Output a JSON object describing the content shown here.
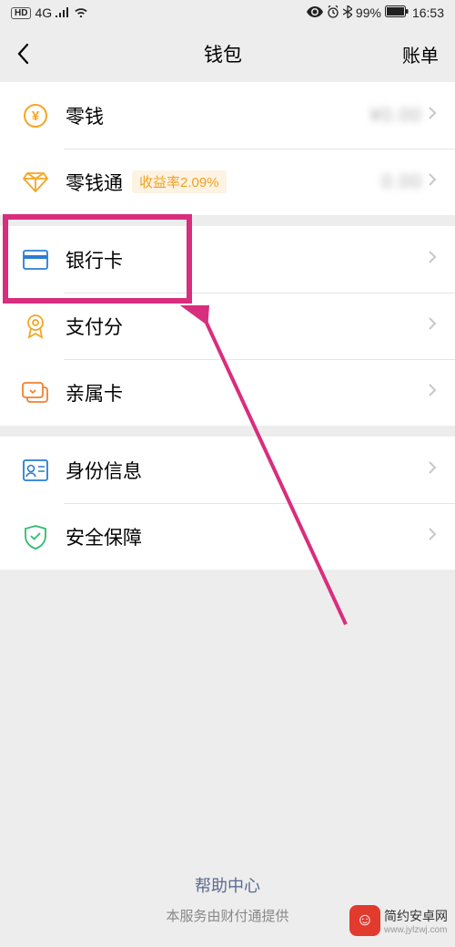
{
  "status": {
    "hd": "HD",
    "network": "4G",
    "battery_pct": "99%",
    "time": "16:53"
  },
  "header": {
    "title": "钱包",
    "right_label": "账单"
  },
  "groups": [
    {
      "items": [
        {
          "name": "balance",
          "icon": "coin",
          "label": "零钱",
          "value": "¥0.00",
          "chevron": true
        },
        {
          "name": "balance-plus",
          "icon": "diamond",
          "label": "零钱通",
          "tag": "收益率2.09%",
          "value": "0.00",
          "chevron": true
        }
      ]
    },
    {
      "items": [
        {
          "name": "bank-card",
          "icon": "card",
          "label": "银行卡",
          "chevron": true
        },
        {
          "name": "pay-score",
          "icon": "badge",
          "label": "支付分",
          "chevron": true
        },
        {
          "name": "family-card",
          "icon": "family-card",
          "label": "亲属卡",
          "chevron": true
        }
      ]
    },
    {
      "items": [
        {
          "name": "identity",
          "icon": "id",
          "label": "身份信息",
          "chevron": true
        },
        {
          "name": "security",
          "icon": "shield",
          "label": "安全保障",
          "chevron": true
        }
      ]
    }
  ],
  "footer": {
    "help": "帮助中心",
    "provider": "本服务由财付通提供"
  },
  "watermark": {
    "brand": "简约安卓网",
    "url": "www.jylzwj.com"
  }
}
